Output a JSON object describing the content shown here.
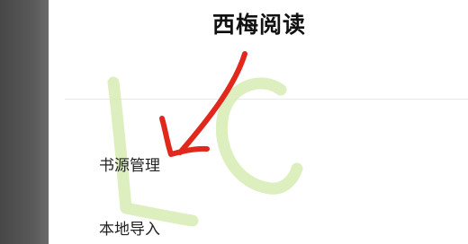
{
  "drawer": {
    "app_title": "西梅阅读",
    "menu": [
      {
        "label": "书源管理"
      },
      {
        "label": "本地导入"
      }
    ]
  },
  "annotations": {
    "watermark_text": "LC",
    "watermark_color": "#d8ecb4",
    "arrow_color": "#e0281c"
  },
  "colors": {
    "scrim": "#555555",
    "background": "#ffffff",
    "text": "#222222"
  }
}
